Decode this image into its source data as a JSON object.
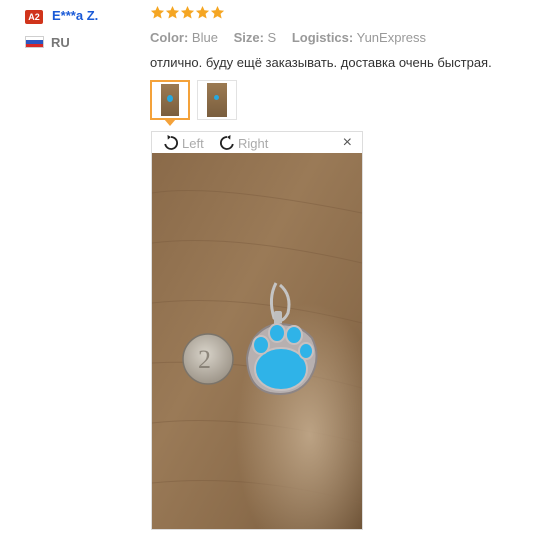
{
  "reviewer": {
    "badge": "A2",
    "name": "E***a Z.",
    "country": "RU"
  },
  "rating": {
    "stars": 5,
    "max": 5,
    "color": "#f5a623"
  },
  "meta": {
    "color_key": "Color:",
    "color_val": "Blue",
    "size_key": "Size:",
    "size_val": "S",
    "logistics_key": "Logistics:",
    "logistics_val": "YunExpress"
  },
  "review_text": "отлично. буду ещё заказывать. доставка очень быстрая.",
  "viewer": {
    "rotate_left": "Left",
    "rotate_right": "Right",
    "close": "×"
  },
  "colors": {
    "badge": "#d0341b",
    "name": "#1a5ad7",
    "accent": "#f4a23a",
    "wood": "#8b6a48",
    "paw": "#2fb3e8"
  }
}
